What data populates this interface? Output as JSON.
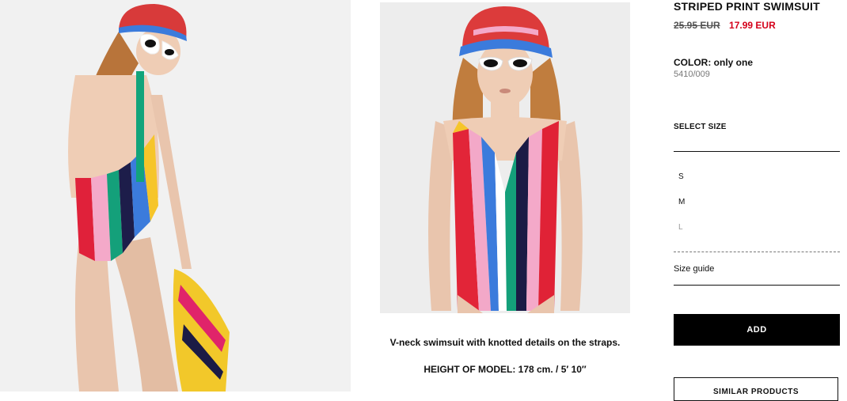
{
  "product": {
    "title": "STRIPED PRINT SWIMSUIT",
    "old_price": "25.95 EUR",
    "new_price": "17.99 EUR",
    "color_line": "COLOR: only one",
    "reference": "5410/009"
  },
  "sizes": {
    "title": "SELECT SIZE",
    "options": [
      {
        "label": "S",
        "available": true
      },
      {
        "label": "M",
        "available": true
      },
      {
        "label": "L",
        "available": false
      }
    ],
    "guide_label": "Size guide"
  },
  "actions": {
    "add_label": "ADD",
    "similar_label": "SIMILAR PRODUCTS"
  },
  "description": {
    "text": "V-neck swimsuit with knotted details on the straps.",
    "model_height": "HEIGHT OF MODEL: 178 cm. / 5′ 10″"
  },
  "colors": {
    "accent_price": "#d4001a",
    "button_bg": "#000000"
  }
}
